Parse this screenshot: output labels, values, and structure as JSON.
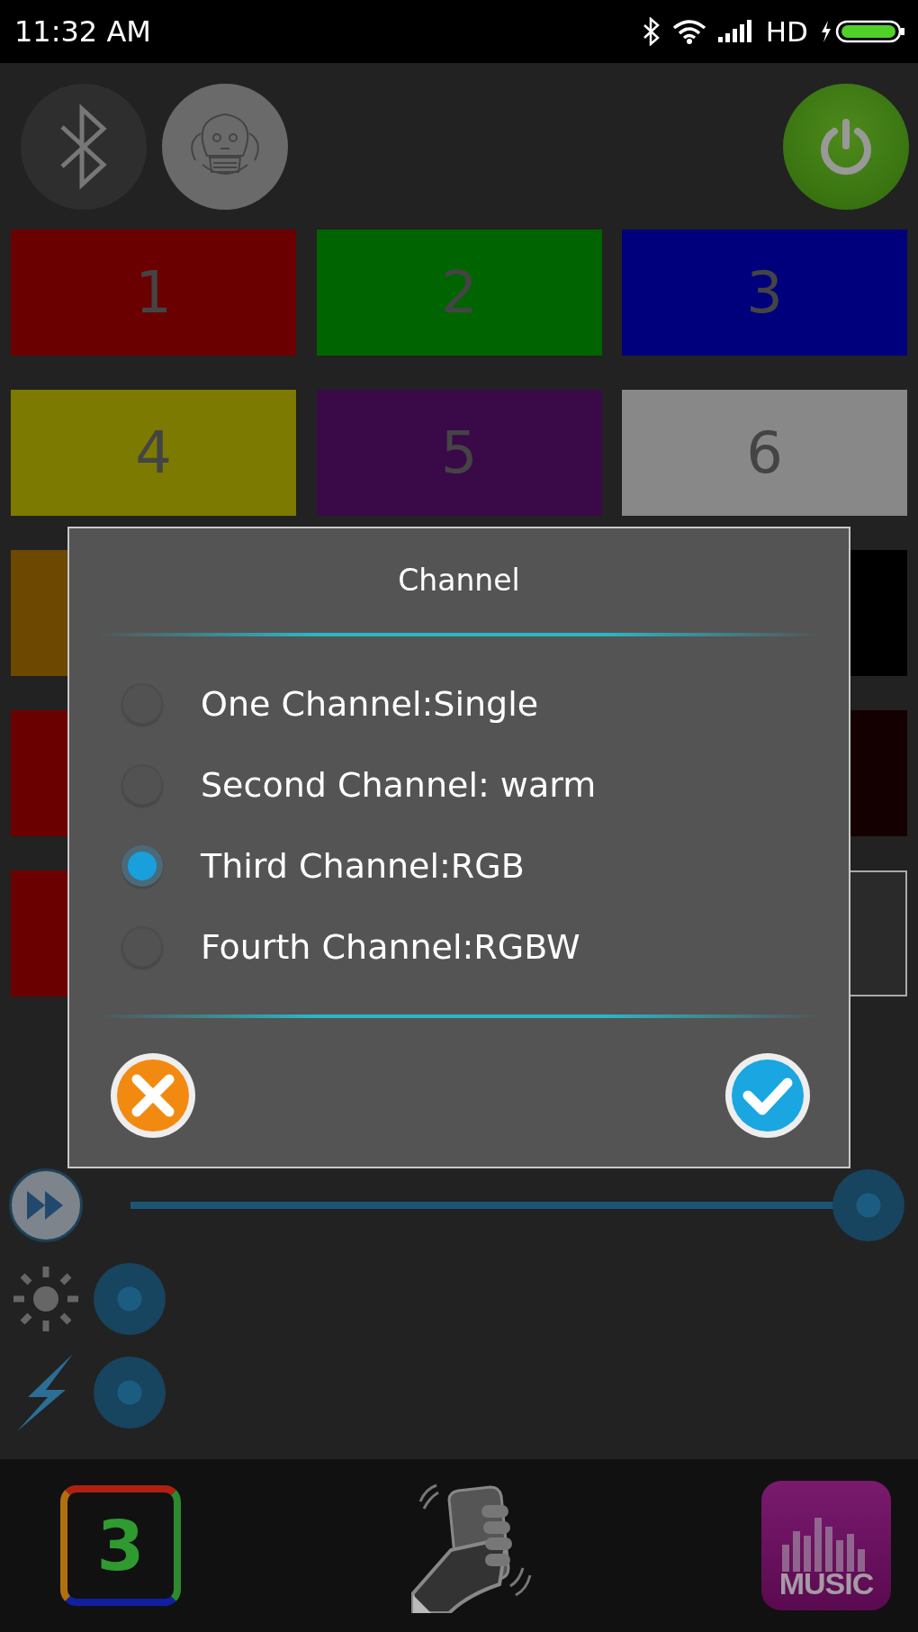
{
  "status_bar": {
    "time": "11:32  AM",
    "network": "HD"
  },
  "top_buttons": [
    {
      "kind": "bluetooth"
    },
    {
      "kind": "bulb"
    },
    {
      "kind": "power"
    }
  ],
  "tile_rows": [
    [
      {
        "label": "1",
        "color": "#6b0000",
        "kind": "filled"
      },
      {
        "label": "2",
        "color": "#006400",
        "kind": "filled"
      },
      {
        "label": "3",
        "color": "#00007c",
        "kind": "filled"
      }
    ],
    [
      {
        "label": "4",
        "color": "#7c7a00",
        "kind": "filled"
      },
      {
        "label": "5",
        "color": "#3a0948",
        "kind": "filled"
      },
      {
        "label": "6",
        "color": "#888888",
        "kind": "filled"
      }
    ],
    [
      {
        "color": "#6c4800",
        "kind": "filled"
      },
      {
        "color": "#000000",
        "kind": "filled"
      }
    ],
    [
      {
        "color": "#6b0000",
        "kind": "filled"
      },
      {
        "color": "#140000",
        "kind": "filled"
      }
    ],
    [
      {
        "color": "#6b0000",
        "kind": "filled"
      },
      {
        "color": "#2a2a2a",
        "kind": "outlined"
      }
    ]
  ],
  "dialog": {
    "title": "Channel",
    "options": [
      {
        "label": "One Channel:Single",
        "selected": false
      },
      {
        "label": "Second Channel: warm",
        "selected": false
      },
      {
        "label": "Third Channel:RGB",
        "selected": true
      },
      {
        "label": "Fourth Channel:RGBW",
        "selected": false
      }
    ],
    "buttons": [
      {
        "kind": "cancel"
      },
      {
        "kind": "confirm"
      }
    ]
  },
  "sliders": [
    {
      "kind": "speed",
      "level": 1
    },
    {
      "kind": "brightness",
      "level": 0
    },
    {
      "kind": "power",
      "level": 0
    }
  ],
  "bottom_nav": [
    {
      "kind": "channel",
      "label": "3"
    },
    {
      "kind": "shake"
    },
    {
      "kind": "music",
      "label": "MUSIC"
    }
  ]
}
